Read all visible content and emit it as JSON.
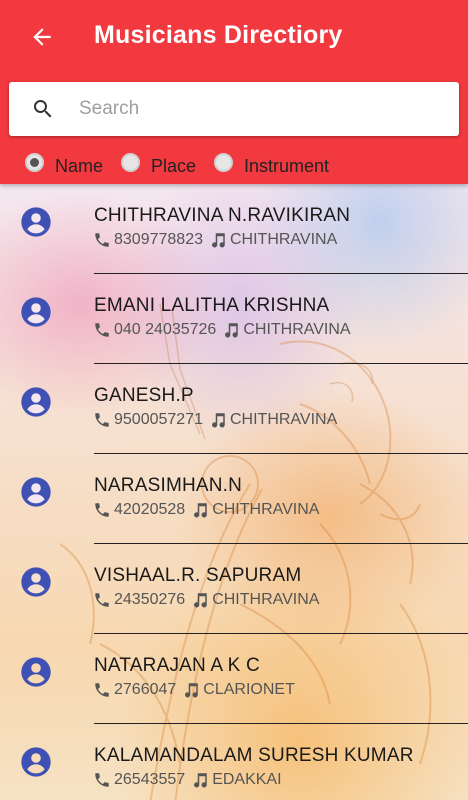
{
  "appbar": {
    "title": "Musicians Directiory",
    "back_icon": "arrow-back-icon",
    "color": "#f2393f"
  },
  "search": {
    "placeholder": "Search",
    "value": "",
    "icon": "search-icon"
  },
  "filter": {
    "options": [
      {
        "label": "Name",
        "checked": true
      },
      {
        "label": "Place",
        "checked": false
      },
      {
        "label": "Instrument",
        "checked": false
      }
    ]
  },
  "musicians": [
    {
      "name": "CHITHRAVINA N.RAVIKIRAN",
      "phone": "8309778823",
      "instrument": "CHITHRAVINA"
    },
    {
      "name": "EMANI LALITHA KRISHNA",
      "phone": "040 24035726",
      "instrument": "CHITHRAVINA"
    },
    {
      "name": "GANESH.P",
      "phone": "9500057271",
      "instrument": "CHITHRAVINA"
    },
    {
      "name": "NARASIMHAN.N",
      "phone": "42020528",
      "instrument": "CHITHRAVINA"
    },
    {
      "name": "VISHAAL.R. SAPURAM",
      "phone": "24350276",
      "instrument": "CHITHRAVINA"
    },
    {
      "name": "NATARAJAN A K C",
      "phone": "2766047",
      "instrument": "CLARIONET"
    },
    {
      "name": "KALAMANDALAM SURESH KUMAR",
      "phone": "26543557",
      "instrument": "EDAKKAI"
    }
  ],
  "colors": {
    "avatar": "#3f51b5",
    "accent": "#f2393f"
  }
}
